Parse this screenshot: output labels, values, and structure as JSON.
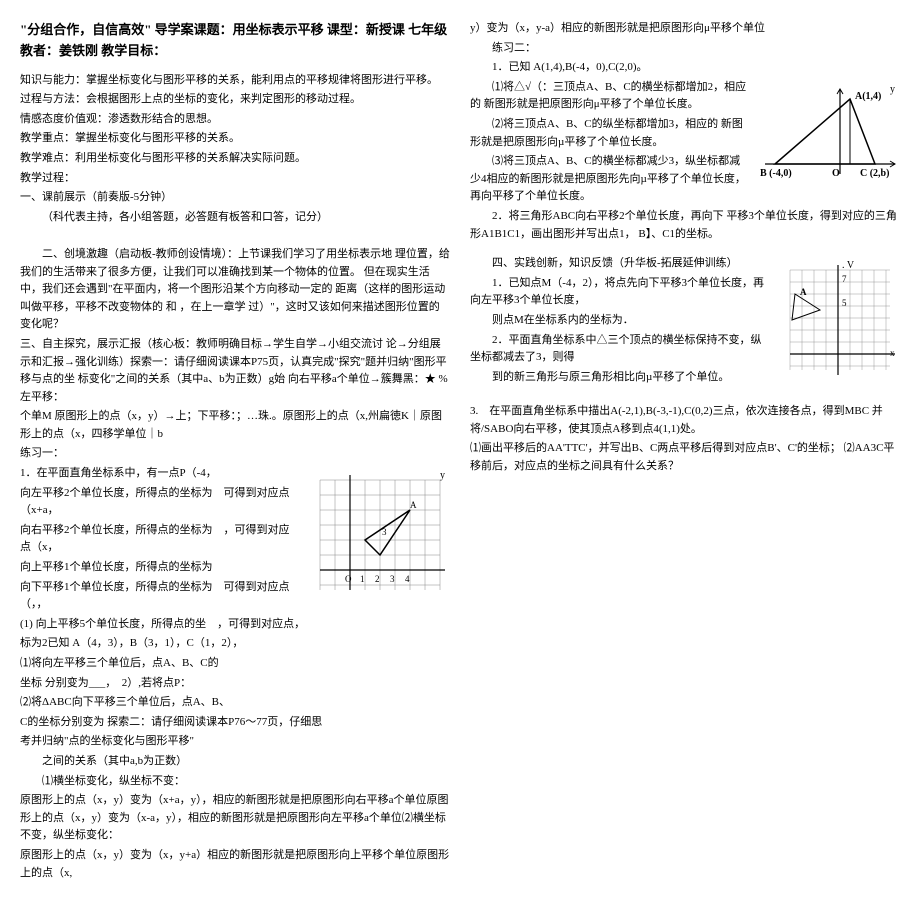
{
  "title": "\"分组合作，自信高效\" 导学案课题：用坐标表示平移 课型：新授课 七年级 教者：姜铁刚 教学目标：",
  "left": {
    "knowledge": "知识与能力：掌握坐标变化与图形平移的关系，能利用点的平移规律将图形进行平移。",
    "process": "过程与方法：会根据图形上点的坐标的变化，来判定图形的移动过程。",
    "attitude": "情感态度价值观：渗透数形结合的思想。",
    "keypoint": "教学重点：掌握坐标变化与图形平移的关系。",
    "difficulty": "教学难点：利用坐标变化与图形平移的关系解决实际问题。",
    "procedure": "教学过程：",
    "step1": "一、课前展示（前奏版-5分钟）",
    "step1_note": "（科代表主持，各小组答题，必答题有板答和口答，记分）",
    "step2": "二、创境激趣（启动板-教师创设情境）：上节课我们学习了用坐标表示地 理位置，给我们的生活带来了很多方便，让我们可以准确找到某一个物体的位置。 但在现实生活中，我们还会遇到\"在平面内，将一个图形沿某个方向移动一定的 距离（这样的图形运动叫做平移，平移不改变物体的 和 ，在上一章学 过）\"，这时又该如何来描述图形位置的变化呢？",
    "step3": "三、自主探究，展示汇报（核心板：教师明确目标→学生自学→小组交流讨 论→分组展示和汇报→强化训练）探索一：请仔细阅读课本P75页，认真完成\"探究\"题并归纳\"图形平移与点的坐 标变化\"之间的关系（其中a、b为正数）g始 向右平移a个单位→簇舞黑：★ %左平移：",
    "step3_line2": "个单M 原图形上的点（x，y）→上；下平移：；…珠.。原图形上的点（x,州扁徳K｜原图形上的点（x，四移学单位｜b",
    "practice1": "练习一：",
    "p1_1": "1．在平面直角坐标系中，有一点P（-4，",
    "p1_2": "向左平移2个单位长度，所得点的坐标为",
    "p1_3": "向右平移2个单位长度，所得点的坐标为",
    "p1_4": "向上平移1个单位长度，所得点的坐标为",
    "p1_5": "向下平移1个单位长度，所得点的坐标为",
    "p1_6": "(1) 向上平移5个单位长度，所得点的坐",
    "p1_7": "标为2已知 A（4，3），B（3，1），C（1，2），",
    "p1_q1": "⑴将向左平移三个单位后，点A、B、C的",
    "p1_q1b": "坐标 分别变为___，",
    "p1_q2": "⑵将ΔABC向下平移三个单位后，点A、B、",
    "p1_q2b": "C的坐标分别变为 探索二：请仔细阅读课本P76～77页，仔细思",
    "p1_q3": "考并归纳\"点的坐标变化与图形平移\"",
    "p1_q3b": "之间的关系（其中a,b为正数）",
    "p1_q4": "⑴横坐标变化，纵坐标不变：",
    "p1_end1": "原图形上的点（x，y）变为（x+a，y），相应的新图形就是把原图形向右平移a个单位原图形上的点（x，y）变为（x-a，y），相应的新图形就是把原图形向左平移a个单位⑵横坐标不变，纵坐标变化：",
    "p1_end2": "原图形上的点（x，y）变为（x，y+a）相应的新图形就是把原图形向上平移个单位原图形上的点（x,",
    "float_text1": "可得到对应点（x+a，",
    "float_text2": "，可得到对应点（x，",
    "float_text3": "可得到对应点（，，",
    "float_text4": "，可得到对应点，",
    "float_text5": "2）,若将点P：",
    "fig_labels": {
      "A": "A",
      "O": "O",
      "1": "1",
      "2": "2",
      "3": "3",
      "4": "4"
    }
  },
  "right": {
    "top": "y）变为（x，y-a）相应的新图形就是把原图形向μ平移个单位",
    "practice2": "练习二：",
    "p2_1": "1．已知 A(1,4),B(-4，0),C(2,0)。",
    "p2_2": "⑴将△√（：三顶点A、B、C的横坐标都增加2，相应的 新图形就是把原图形向μ平移了个单位长度。",
    "p2_3": "⑵将三顶点A、B、C的纵坐标都增加3，相应的 新图形就是把原图形向µ平移了个单位长度。",
    "p2_4": "⑶将三顶点A、B、C的横坐标都减少3，纵坐标都减少4相应的新图形就是把原图形先向µ平移了个单位长度，再向平移了个单位长度。",
    "p2_5": "2．将三角形ABC向右平移2个单位长度，再向下 平移3个单位长度，得到对应的三角形A1B1C1，画出图形并写出点1， B】、C1的坐标。",
    "tri_A": "A(1,4)",
    "tri_B": "B (-4,0)",
    "tri_O": "O",
    "tri_C": "C (2,b)",
    "step4": "四、实践创新，知识反馈（升华板-拓展延伸训练）",
    "p4_1": "1．已知点M（-4，2），将点先向下平移3个单位长度，再向左平移3个单位长度，",
    "p4_1b": "则点M在坐标系内的坐标为．",
    "p4_2": "2．平面直角坐标系中△三个顶点的横坐标保持不变，纵坐标都减去了3，则得",
    "p4_2b": "到的新三角形与原三角形相比向µ平移了个单位。",
    "grid_v": "v",
    "grid_7": "7",
    "grid_a": "A",
    "grid_5": "5",
    "p4_3": "3.　在平面直角坐标系中描出A(-2,1),B(-3,-1),C(0,2)三点，依次连接各点，得到MBC 并将/SABO向右平移，使其顶点A移到点4(1,1)处。",
    "p4_3b": "⑴画出平移后的AA'TTC'，并写出B、C两点平移后得到对应点B'、C'的坐标； ⑵AA3C平移前后，对应点的坐标之间具有什么关系？"
  }
}
